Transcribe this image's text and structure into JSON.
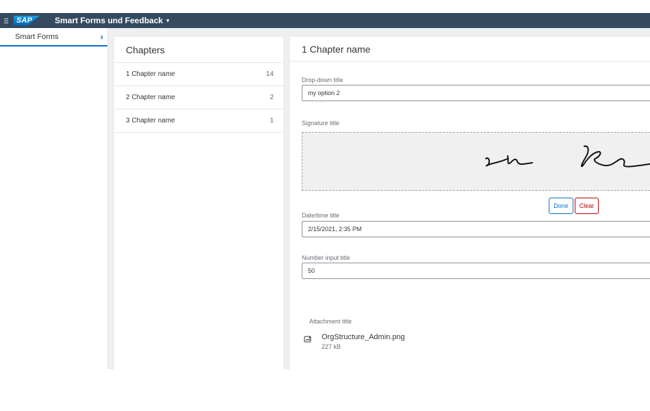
{
  "shell": {
    "logo": "SAP",
    "app_title": "Smart Forms und Feedback",
    "app_title_caret": "▾"
  },
  "leftnav": {
    "items": [
      {
        "label": "Smart Forms",
        "chevron": "›"
      }
    ]
  },
  "chapters": {
    "title": "Chapters",
    "items": [
      {
        "label": "1 Chapter name",
        "count": "14"
      },
      {
        "label": "2 Chapter name",
        "count": "2"
      },
      {
        "label": "3 Chapter name",
        "count": "1"
      }
    ]
  },
  "detail": {
    "title": "1 Chapter name",
    "dropdown": {
      "label": "Drop-down title",
      "value": "my option 2"
    },
    "signature": {
      "label": "Signature title",
      "done_label": "Done",
      "clear_label": "Clear"
    },
    "datetime": {
      "label": "Date/time title",
      "value": "2/15/2021, 2:35 PM"
    },
    "number": {
      "label": "Number input title",
      "value": "50"
    },
    "attachment": {
      "label": "Attachment title",
      "file_name": "OrgStructure_Admin.png",
      "file_size": "227 kB",
      "icon": "image-file-icon"
    }
  },
  "colors": {
    "shellbar": "#354a5f",
    "accent": "#0a6ed1",
    "negative": "#bb0000",
    "background": "#edeff0"
  }
}
